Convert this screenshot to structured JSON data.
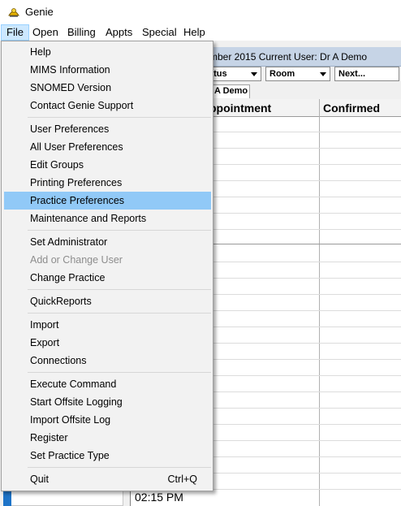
{
  "window": {
    "title": "Genie",
    "icon": "genie-app-icon"
  },
  "menubar": [
    "File",
    "Open",
    "Billing",
    "Appts",
    "Special",
    "Help"
  ],
  "background": {
    "header_text": "mber 2015   Current User: Dr A Demo",
    "combos": [
      "atus",
      "Room",
      "Next..."
    ],
    "tab_label": "A Demo",
    "columns": [
      "ppointment",
      "Confirmed"
    ],
    "time_cell": "02:15 PM"
  },
  "file_menu": {
    "groups": [
      [
        "Help",
        "MIMS Information",
        "SNOMED Version",
        "Contact Genie Support"
      ],
      [
        "User Preferences",
        "All User Preferences",
        "Edit Groups",
        "Printing Preferences",
        "Practice Preferences",
        "Maintenance and Reports"
      ],
      [
        "Set Administrator",
        "Add or Change User",
        "Change Practice"
      ],
      [
        "QuickReports"
      ],
      [
        "Import",
        "Export",
        "Connections"
      ],
      [
        "Execute Command",
        "Start Offsite Logging",
        "Import Offsite Log",
        "Register",
        "Set Practice Type"
      ],
      [
        "Quit"
      ]
    ],
    "highlighted": "Practice Preferences",
    "disabled": [
      "Add or Change User"
    ],
    "quit_shortcut": "Ctrl+Q"
  },
  "colors": {
    "highlight": "#91c9f7",
    "menu_bg": "#f2f2f2",
    "active_menu": "#cce8ff",
    "header_strip": "#c6d4e6"
  }
}
